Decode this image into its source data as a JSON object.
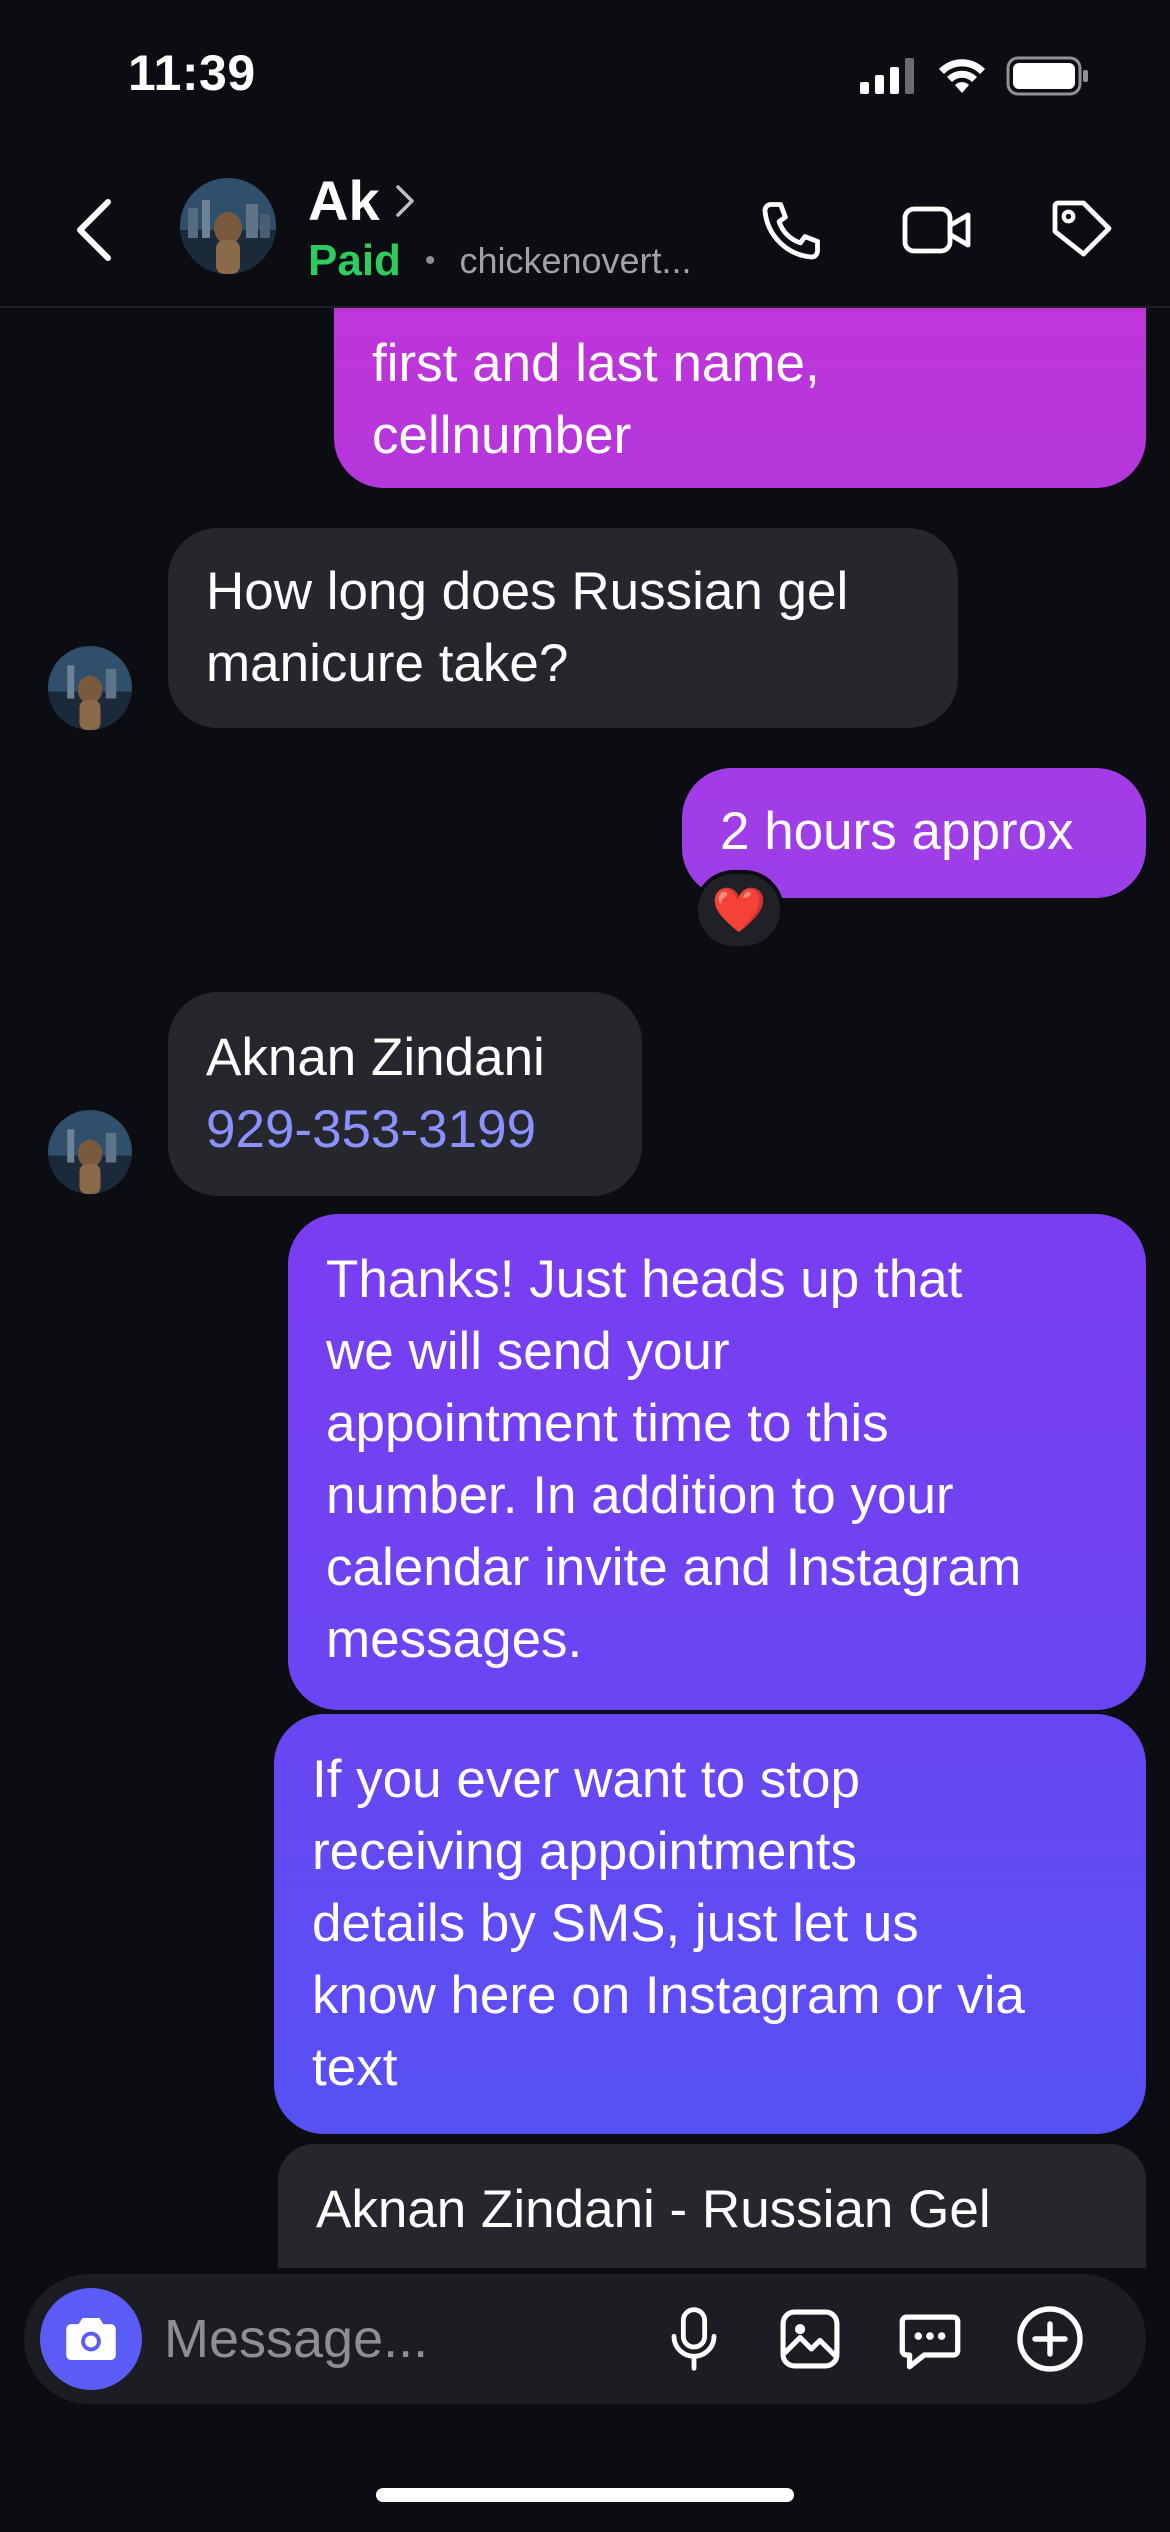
{
  "status_bar": {
    "time": "11:39"
  },
  "header": {
    "contact_name": "Ak",
    "paid_label": "Paid",
    "separator": "•",
    "handle": "chickenovert..."
  },
  "messages": [
    {
      "direction": "outgoing",
      "lines": [
        "first and last name,",
        "cellnumber"
      ]
    },
    {
      "direction": "incoming",
      "lines": [
        "How long does Russian gel",
        "manicure take?"
      ]
    },
    {
      "direction": "outgoing",
      "lines": [
        "2 hours approx"
      ],
      "reaction": "❤️"
    },
    {
      "direction": "incoming",
      "name": "Aknan Zindani",
      "phone": "929-353-3199"
    },
    {
      "direction": "outgoing",
      "lines": [
        "Thanks! Just heads up that",
        "we will send your",
        "appointment time to this",
        "number. In addition to your",
        "calendar invite and Instagram",
        "messages."
      ]
    },
    {
      "direction": "outgoing",
      "lines": [
        "If you ever want to stop",
        "receiving appointments",
        "details by SMS, just let us",
        "know here on Instagram or via",
        "text"
      ]
    },
    {
      "direction": "outgoing",
      "lines": [
        "Aknan Zindani - Russian Gel"
      ]
    }
  ],
  "composer": {
    "placeholder": "Message..."
  },
  "colors": {
    "background": "#0b0d12",
    "incoming_bubble": "#25272d",
    "paid_green": "#2ecc5f",
    "phone_link": "#8b92ff",
    "camera_button": "#5b5cf6",
    "outgoing_gradient_top": "#c334d8",
    "outgoing_gradient_bottom": "#5651f4"
  },
  "icons": [
    "back-chevron-icon",
    "audio-call-icon",
    "video-call-icon",
    "tag-icon",
    "camera-icon",
    "microphone-icon",
    "gallery-icon",
    "sticker-icon",
    "add-icon"
  ]
}
